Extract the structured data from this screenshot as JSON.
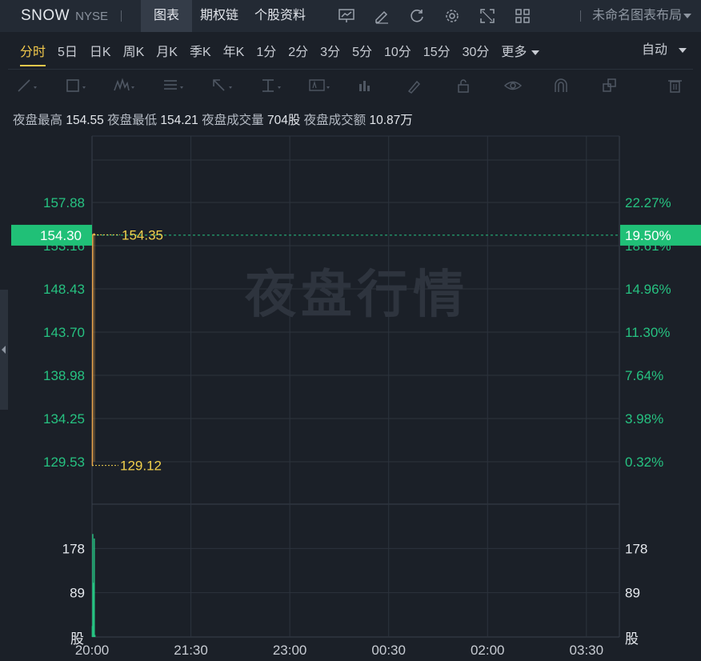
{
  "header": {
    "ticker": "SNOW",
    "exchange": "NYSE",
    "tabs": [
      "图表",
      "期权链",
      "个股资料"
    ],
    "active_tab": "图表",
    "layout_name": "未命名图表布局"
  },
  "icons": [
    "chart-line-icon",
    "edit-icon",
    "refresh-icon",
    "gear-icon",
    "fullscreen-icon",
    "grid-icon"
  ],
  "periods": [
    "分时",
    "5日",
    "日K",
    "周K",
    "月K",
    "季K",
    "年K",
    "1分",
    "2分",
    "3分",
    "5分",
    "10分",
    "15分",
    "30分",
    "更多"
  ],
  "active_period": "分时",
  "auto_label": "自动",
  "draw_tools": [
    "line-tool-icon",
    "rect-tool-icon",
    "wave-tool-icon",
    "fib-tool-icon",
    "arrow-tool-icon",
    "measure-tool-icon",
    "text-tool-icon",
    "bar-tool-icon",
    "pen-icon",
    "lock-icon",
    "eye-icon",
    "magnet-icon",
    "layers-icon",
    "trash-icon"
  ],
  "info": {
    "high_label": "夜盘最高",
    "high_value": "154.55",
    "low_label": "夜盘最低",
    "low_value": "154.21",
    "volume_label": "夜盘成交量",
    "volume_value": "704股",
    "amount_label": "夜盘成交额",
    "amount_value": "10.87万"
  },
  "watermark": "夜盘行情",
  "colors": {
    "up": "#26c281",
    "price_line": "#e8a24a",
    "highlight": "#f2d14c",
    "current_badge": "#20c077"
  },
  "chart_data": {
    "type": "line",
    "price_ticks": [
      {
        "value": 157.88,
        "label": "157.88"
      },
      {
        "value": 153.16,
        "label": "153.16"
      },
      {
        "value": 148.43,
        "label": "148.43"
      },
      {
        "value": 143.7,
        "label": "143.70"
      },
      {
        "value": 138.98,
        "label": "138.98"
      },
      {
        "value": 134.25,
        "label": "134.25"
      },
      {
        "value": 129.53,
        "label": "129.53"
      }
    ],
    "pct_ticks": [
      {
        "value": 157.88,
        "label": "22.27%"
      },
      {
        "value": 153.16,
        "label": "18.61%"
      },
      {
        "value": 148.43,
        "label": "14.96%"
      },
      {
        "value": 143.7,
        "label": "11.30%"
      },
      {
        "value": 138.98,
        "label": "7.64%"
      },
      {
        "value": 134.25,
        "label": "3.98%"
      },
      {
        "value": 129.53,
        "label": "0.32%"
      }
    ],
    "ylim": [
      129.53,
      157.88
    ],
    "x_ticks": [
      {
        "t": 0,
        "label": "20:00"
      },
      {
        "t": 90,
        "label": "21:30"
      },
      {
        "t": 180,
        "label": "23:00"
      },
      {
        "t": 270,
        "label": "00:30"
      },
      {
        "t": 360,
        "label": "02:00"
      },
      {
        "t": 450,
        "label": "03:30"
      }
    ],
    "xlim": [
      0,
      480
    ],
    "price_series": [
      {
        "t": 0,
        "v": 129.12
      },
      {
        "t": 0.3,
        "v": 129.12
      },
      {
        "t": 0.6,
        "v": 154.35
      },
      {
        "t": 2,
        "v": 154.45
      },
      {
        "t": 3,
        "v": 154.3
      }
    ],
    "high_marker": {
      "value": 154.35,
      "label": "154.35"
    },
    "low_marker": {
      "value": 129.12,
      "label": "129.12"
    },
    "current_price": {
      "value": 154.3,
      "label": "154.30",
      "pct_label": "19.50%"
    },
    "volume_ticks": [
      {
        "value": 178,
        "label": "178"
      },
      {
        "value": 89,
        "label": "89"
      }
    ],
    "volume_unit": "股",
    "volume_ylim": [
      0,
      267
    ],
    "volume_bars": [
      {
        "t": 0.2,
        "v": 22
      },
      {
        "t": 0.6,
        "v": 207
      },
      {
        "t": 1.4,
        "v": 109
      },
      {
        "t": 2.0,
        "v": 198
      },
      {
        "t": 2.6,
        "v": 4
      }
    ]
  }
}
